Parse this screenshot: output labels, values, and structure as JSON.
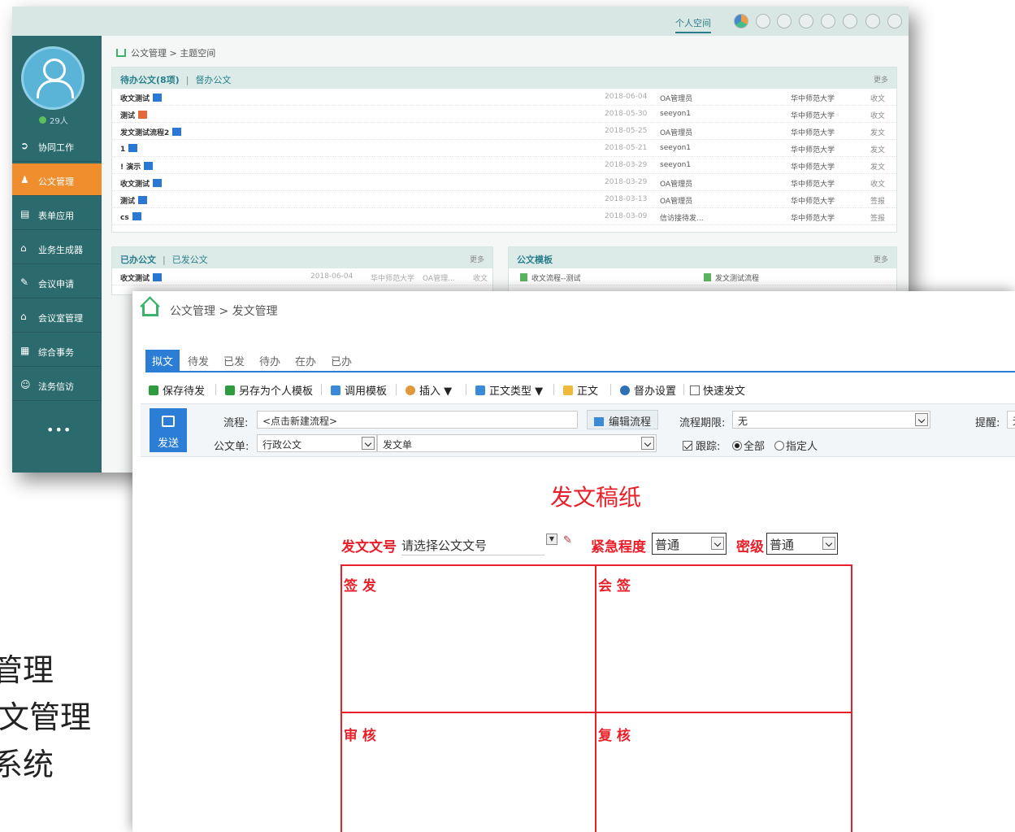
{
  "background_text": [
    "管理",
    "发文管理",
    "系统"
  ],
  "back_window": {
    "header_space": "个人空间",
    "online_count": "29人",
    "sidebar": [
      {
        "label": "协同工作",
        "icon": "share-icon"
      },
      {
        "label": "公文管理",
        "icon": "stamp-icon",
        "active": true
      },
      {
        "label": "表单应用",
        "icon": "form-icon"
      },
      {
        "label": "业务生成器",
        "icon": "home-build-icon"
      },
      {
        "label": "会议申请",
        "icon": "pen-icon"
      },
      {
        "label": "会议室管理",
        "icon": "house-icon"
      },
      {
        "label": "综合事务",
        "icon": "doc-icon"
      },
      {
        "label": "法务信访",
        "icon": "person-icon"
      }
    ],
    "sidebar_more": "•••",
    "breadcrumb": "公文管理 > 主题空间",
    "pending_panel": {
      "tab1": "待办公文(8项)",
      "sep": "|",
      "tab2": "督办公文",
      "more": "更多",
      "rows": [
        {
          "title": "收文测试",
          "date": "2018-06-04",
          "user": "OA管理员",
          "org": "华中师范大学",
          "kind": "收文"
        },
        {
          "title": "测试",
          "date": "2018-05-30",
          "user": "seeyon1",
          "org": "华中师范大学",
          "kind": "收文"
        },
        {
          "title": "发文测试流程2",
          "date": "2018-05-25",
          "user": "OA管理员",
          "org": "华中师范大学",
          "kind": "发文"
        },
        {
          "title": "1",
          "date": "2018-05-21",
          "user": "seeyon1",
          "org": "华中师范大学",
          "kind": "发文"
        },
        {
          "title": "! 演示",
          "date": "2018-03-29",
          "user": "seeyon1",
          "org": "华中师范大学",
          "kind": "发文"
        },
        {
          "title": "收文测试",
          "date": "2018-03-29",
          "user": "OA管理员",
          "org": "华中师范大学",
          "kind": "收文"
        },
        {
          "title": "测试",
          "date": "2018-03-13",
          "user": "OA管理员",
          "org": "华中师范大学",
          "kind": "签报"
        },
        {
          "title": "cs",
          "date": "2018-03-09",
          "user": "信访接待发...",
          "org": "华中师范大学",
          "kind": "签报"
        }
      ]
    },
    "done_panel": {
      "tab1": "已办公文",
      "sep": "|",
      "tab2": "已发公文",
      "more": "更多",
      "row": {
        "title": "收文测试",
        "date": "2018-06-04",
        "org": "华中师范大学",
        "user": "OA管理...",
        "kind": "收文"
      }
    },
    "template_panel": {
      "title": "公文模板",
      "more": "更多",
      "items": [
        "收文流程--测试",
        "发文测试流程"
      ]
    }
  },
  "front_window": {
    "breadcrumb": "公文管理 > 发文管理",
    "tabs": [
      "拟文",
      "待发",
      "已发",
      "待办",
      "在办",
      "已办"
    ],
    "toolbar": [
      "保存待发",
      "另存为个人模板",
      "调用模板",
      "插入 ▼",
      "正文类型 ▼",
      "正文",
      "督办设置",
      "快速发文"
    ],
    "send": "发送",
    "flow_label": "流程:",
    "flow_value": "<点击新建流程>",
    "edit_flow": "编辑流程",
    "deadline_label": "流程期限:",
    "deadline_value": "无",
    "remind_label": "提醒:",
    "remind_value": "无",
    "doc_form_label": "公文单:",
    "doc_form_value": "行政公文",
    "doc_form_value2": "发文单",
    "track_label": "跟踪:",
    "track_all": "全部",
    "track_person": "指定人",
    "doc_title": "发文稿纸",
    "doc_number_label": "发文文号",
    "doc_number_placeholder": "请选择公文文号",
    "urgency_label": "紧急程度",
    "urgency_value": "普通",
    "secret_label": "密级",
    "secret_value": "普通",
    "cells": [
      "签 发",
      "会 签",
      "审 核",
      "复 核"
    ]
  }
}
